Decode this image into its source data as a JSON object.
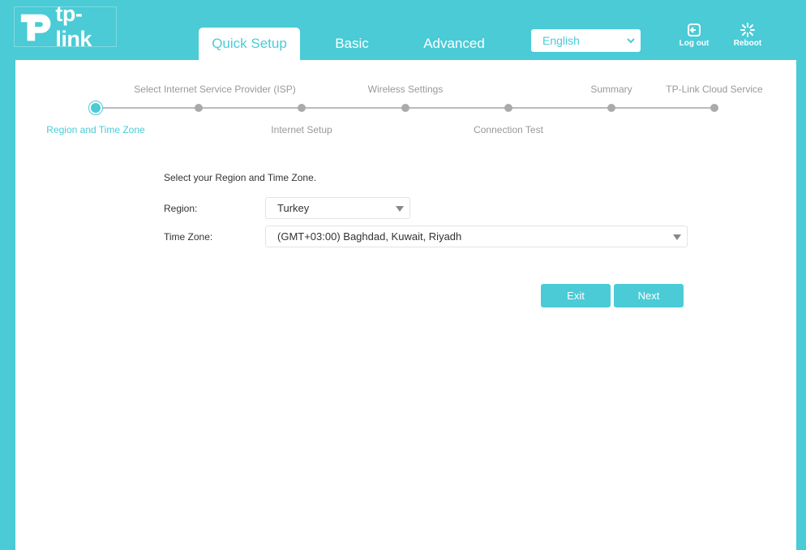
{
  "brand": {
    "name": "tp-link"
  },
  "tabs": [
    {
      "label": "Quick Setup",
      "active": true
    },
    {
      "label": "Basic",
      "active": false
    },
    {
      "label": "Advanced",
      "active": false
    }
  ],
  "language": {
    "selected": "English"
  },
  "header_actions": {
    "logout_label": "Log out",
    "reboot_label": "Reboot"
  },
  "stepper": {
    "steps": [
      {
        "label": "Region and Time Zone",
        "current": true
      },
      {
        "label": "Select Internet Service Provider (ISP)"
      },
      {
        "label": "Internet Setup"
      },
      {
        "label": "Wireless Settings"
      },
      {
        "label": "Connection Test"
      },
      {
        "label": "Summary"
      },
      {
        "label": "TP-Link Cloud Service"
      }
    ]
  },
  "form": {
    "intro": "Select your Region and Time Zone.",
    "region_label": "Region:",
    "region_value": "Turkey",
    "timezone_label": "Time Zone:",
    "timezone_value": "(GMT+03:00) Baghdad, Kuwait, Riyadh"
  },
  "buttons": {
    "exit": "Exit",
    "next": "Next"
  },
  "colors": {
    "accent": "#4acbd6",
    "inactive": "#aaaaaa"
  }
}
